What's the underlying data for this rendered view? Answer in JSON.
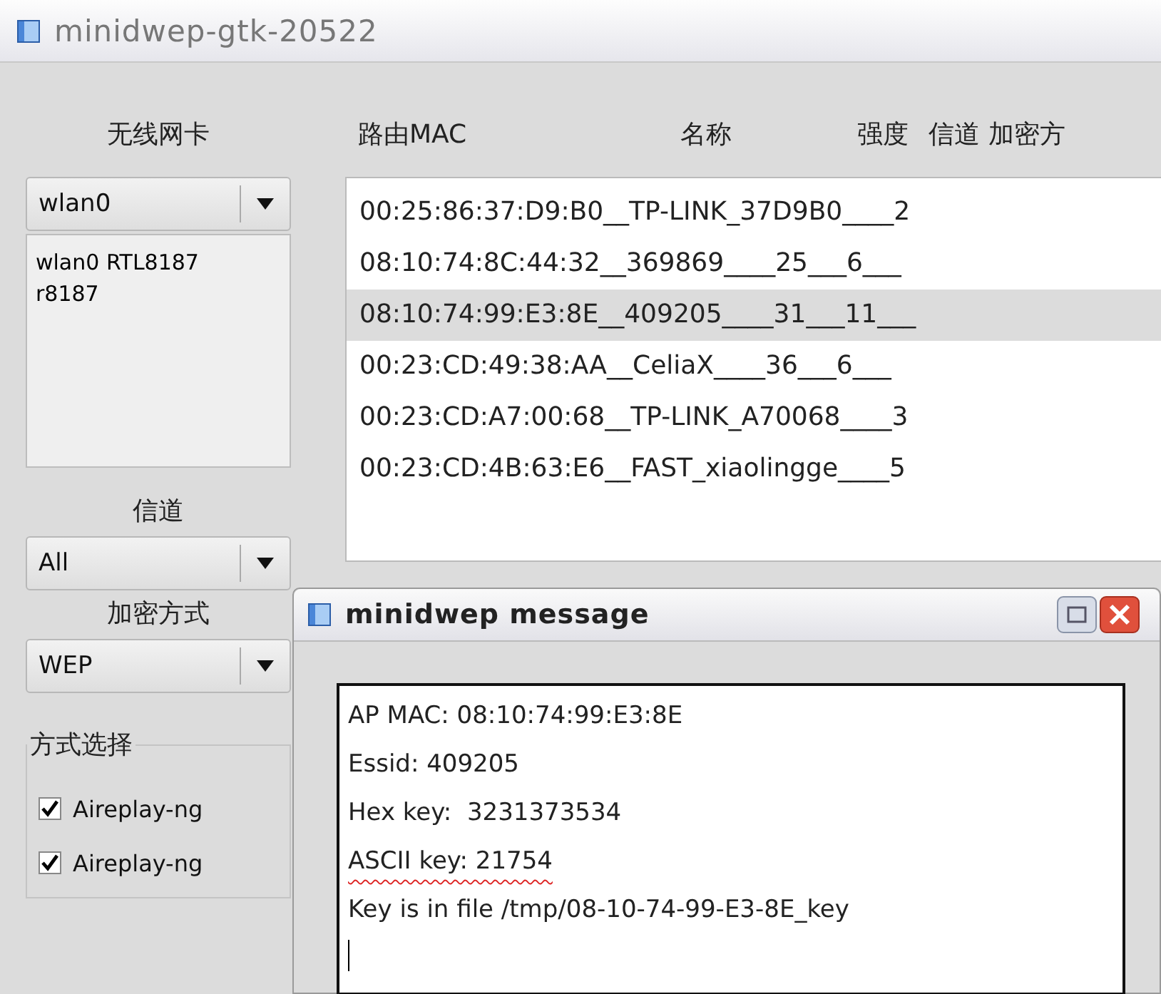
{
  "window": {
    "title": "minidwep-gtk-20522"
  },
  "sidebar": {
    "card_label": "无线网卡",
    "card_combo": {
      "value": "wlan0"
    },
    "card_info": [
      "wlan0 RTL8187",
      "r8187"
    ],
    "channel_label": "信道",
    "channel_combo": {
      "value": "All"
    },
    "encryption_label": "加密方式",
    "encryption_combo": {
      "value": "WEP"
    },
    "method_group": {
      "title": "方式选择",
      "options": [
        {
          "label": "Aireplay-ng",
          "checked": true
        },
        {
          "label": "Aireplay-ng",
          "checked": true
        }
      ]
    }
  },
  "table": {
    "columns": [
      "路由MAC",
      "名称",
      "强度",
      "信道",
      "加密方"
    ],
    "rows": [
      {
        "text": "00:25:86:37:D9:B0__TP-LINK_37D9B0____2",
        "selected": false
      },
      {
        "text": "08:10:74:8C:44:32__369869____25___6___",
        "selected": false
      },
      {
        "text": "08:10:74:99:E3:8E__409205____31___11___",
        "selected": true
      },
      {
        "text": "00:23:CD:49:38:AA__CeliaX____36___6___",
        "selected": false
      },
      {
        "text": "00:23:CD:A7:00:68__TP-LINK_A70068____3",
        "selected": false
      },
      {
        "text": "00:23:CD:4B:63:E6__FAST_xiaolingge____5",
        "selected": false
      }
    ]
  },
  "dialog": {
    "title": "minidwep message",
    "lines": [
      {
        "text": "AP MAC: 08:10:74:99:E3:8E",
        "misspelled": false
      },
      {
        "text": "Essid: 409205",
        "misspelled": false
      },
      {
        "text": "Hex key:  3231373534",
        "misspelled": false
      },
      {
        "text": "ASCII key: 21754",
        "misspelled": true
      },
      {
        "text": "Key is in file /tmp/08-10-74-99-E3-8E_key",
        "misspelled": false
      }
    ]
  }
}
